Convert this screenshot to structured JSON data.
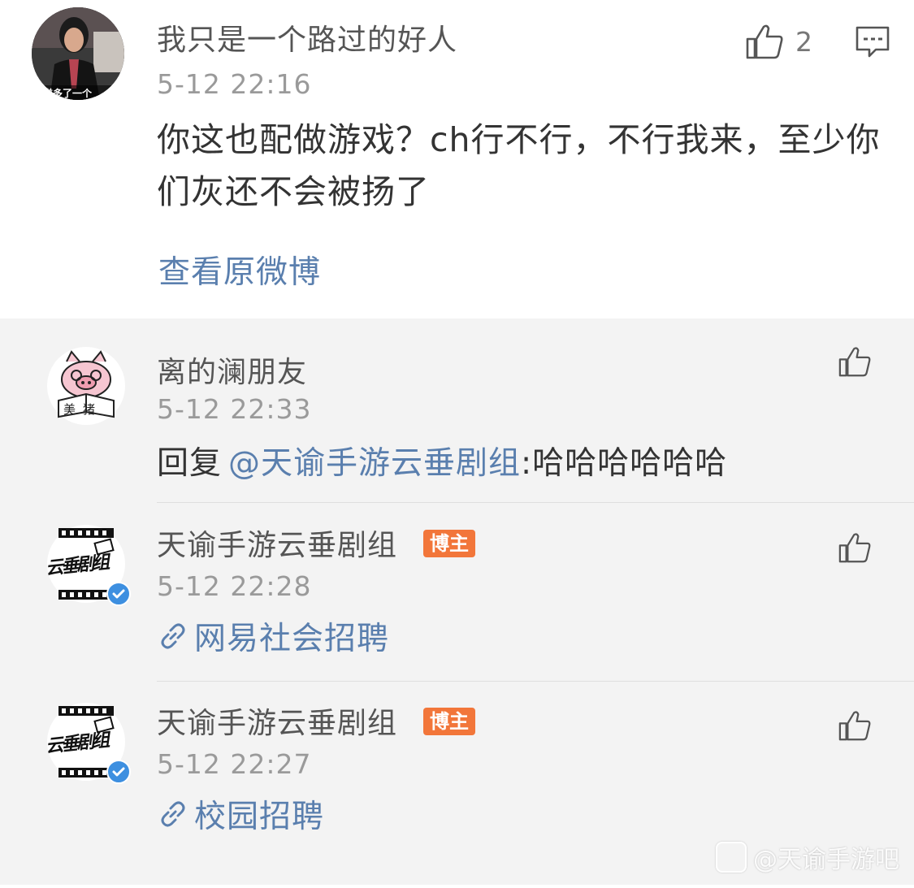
{
  "main_comment": {
    "username": "我只是一个路过的好人",
    "timestamp": "5-12 22:16",
    "like_count": "2",
    "text": "你这也配做游戏？ch行不行，不行我来，至少你们灰还不会被扬了",
    "view_original_label": "查看原微博",
    "avatar_caption": "嫌多了一个"
  },
  "replies": [
    {
      "username": "离的澜朋友",
      "timestamp": "5-12 22:33",
      "prefix": "回复",
      "mention": "@天谕手游云垂剧组",
      "body": ":哈哈哈哈哈哈",
      "avatar_caption": "美猪"
    },
    {
      "username": "天谕手游云垂剧组",
      "badge": "博主",
      "timestamp": "5-12 22:28",
      "link_text": "网易社会招聘",
      "avatar_caption": "云垂剧组"
    },
    {
      "username": "天谕手游云垂剧组",
      "badge": "博主",
      "timestamp": "5-12 22:27",
      "link_text": "校园招聘",
      "avatar_caption": "云垂剧组"
    }
  ],
  "watermark": "@天谕手游吧",
  "colors": {
    "link": "#5a7fae",
    "badge": "#f2763a",
    "reply_background": "#f3f3f3",
    "verified": "#3d8fe0"
  },
  "icons": {
    "like": "thumbs-up-icon",
    "comment": "comment-bubble-icon",
    "link": "link-icon",
    "verified": "verified-check-icon"
  }
}
